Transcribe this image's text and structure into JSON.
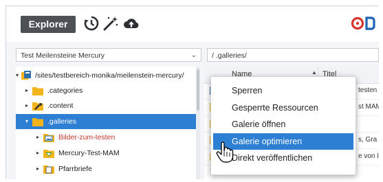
{
  "toolbar": {
    "explorer_label": "Explorer",
    "icons": [
      "history-icon",
      "magic-wand-icon",
      "upload-cloud-icon",
      "opencms-logo"
    ]
  },
  "site_select": {
    "value": "Test Meilensteine Mercury"
  },
  "path_field": {
    "value": "/ .galleries/"
  },
  "tree": {
    "root": "/sites/testbereich-monika/meilenstein-mercury/",
    "items": [
      {
        "label": ".categories",
        "icon": "folder-icon"
      },
      {
        "label": ".content",
        "icon": "content-folder-icon"
      },
      {
        "label": ".galleries",
        "icon": "folder-icon",
        "selected": true
      },
      {
        "label": "Bilder-zum-testen",
        "icon": "image-gallery-icon",
        "changed": true
      },
      {
        "label": "Mercury-Test-MAM",
        "icon": "download-gallery-icon"
      },
      {
        "label": "Pfarrbriefe",
        "icon": "download-gallery-icon"
      }
    ]
  },
  "list": {
    "columns": {
      "name": "Name",
      "title": "Titel"
    },
    "rows": [
      {
        "title": "testen"
      },
      {
        "title": "st MAM"
      },
      {
        "title": ""
      },
      {
        "title": "s, Gra"
      },
      {
        "title": "e von I"
      }
    ]
  },
  "context_menu": {
    "items": [
      {
        "label": "Sperren"
      },
      {
        "label": "Gesperrte Ressourcen"
      },
      {
        "label": "Galerie öffnen"
      },
      {
        "label": "Galerie optimieren",
        "active": true
      },
      {
        "label": "Direkt veröffentlichen"
      }
    ]
  },
  "colors": {
    "selection": "#2d7fd3",
    "toolbar_button": "#4d5156",
    "changed_text": "#c43a2b",
    "logo_red": "#d9342b",
    "logo_blue": "#1d62b4"
  }
}
